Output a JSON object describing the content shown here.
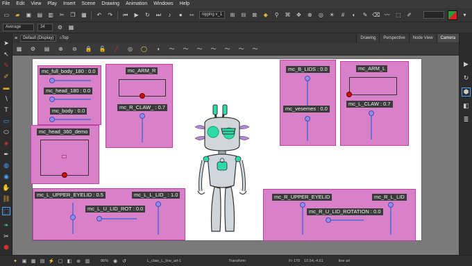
{
  "menubar": {
    "items": [
      "File",
      "Edit",
      "View",
      "Play",
      "Insert",
      "Scene",
      "Drawing",
      "Animation",
      "Windows",
      "Help"
    ]
  },
  "toolbar": {
    "rig_dropdown": "rigging v_1",
    "quality_dropdown": "Average",
    "quality_value": "34"
  },
  "view": {
    "menu_icon": "hamburger-icon",
    "display_dropdown": "Default (Display)",
    "top_label": "Top",
    "tabs": [
      "Drawing",
      "Perspective",
      "Node View",
      "Camera"
    ],
    "active_tab": "Camera"
  },
  "sliders": {
    "full_body": "mc_full_body_180 : 0.0",
    "head": "mc_head_180 : 0.0",
    "body": "mc_body : 0.0",
    "head_demo": "mc_head_360_demo",
    "arm_r": "mc_ARM_R",
    "r_claw": "mc_R_CLAW_ : 0.7",
    "b_lids": "mc_B_LIDS : 0.0",
    "visemes": "mc_vesemes : 0.0",
    "arm_l": "mc_ARM_L",
    "l_claw": "mc_L_CLAW : 0.7",
    "l_upper_eyelid": "mc_L_UPPER_EYELID : 0.5",
    "l_l_lid": "mc_L_L_LID_ : 1.0",
    "l_u_lid_rot": "mc_L_U_LID_ROT : 0.0",
    "r_upper_eyelid": "mc_R_UPPER_EYELID",
    "r_l_lid": "mc_R_L_LID",
    "r_u_lid_rotation": "mc_R_U_LID_ROTATION : 0.0"
  },
  "statusbar": {
    "zoom": "86%",
    "layer": "L_claw_L_line_art-1",
    "mode": "Transform",
    "frame": "Fr 170",
    "coords": "10.54,-4.61",
    "tool": "line art"
  },
  "colors": {
    "panel_fill": "#d880c8",
    "panel_border": "#c040a8",
    "slider": "#6f6fd6",
    "robot_accent": "#2fd9a8"
  }
}
